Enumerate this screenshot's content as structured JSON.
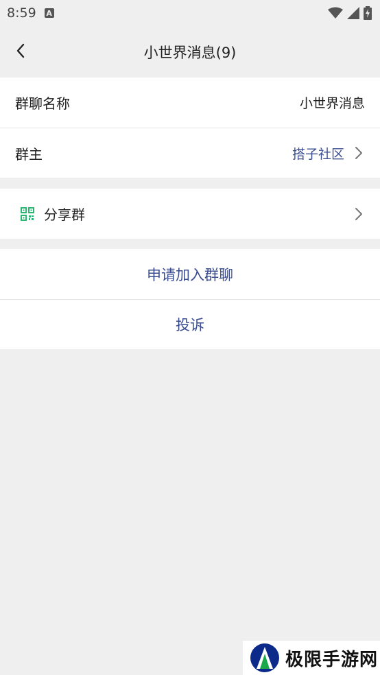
{
  "status_bar": {
    "time": "8:59",
    "notification_icon": "a-letter-icon",
    "icons": [
      "wifi-icon",
      "signal-icon",
      "battery-charging-icon"
    ]
  },
  "header": {
    "title": "小世界消息(9)",
    "back_icon": "chevron-left-icon"
  },
  "info_section": {
    "group_name_label": "群聊名称",
    "group_name_value": "小世界消息",
    "owner_label": "群主",
    "owner_value": "搭子社区"
  },
  "share_section": {
    "share_label": "分享群",
    "share_icon": "qr-code-icon"
  },
  "actions": {
    "join_label": "申请加入群聊",
    "report_label": "投诉"
  },
  "watermark": {
    "text": "极限手游网"
  },
  "colors": {
    "background": "#efefef",
    "link": "#3b4d8f",
    "qr_green": "#2bb673"
  }
}
